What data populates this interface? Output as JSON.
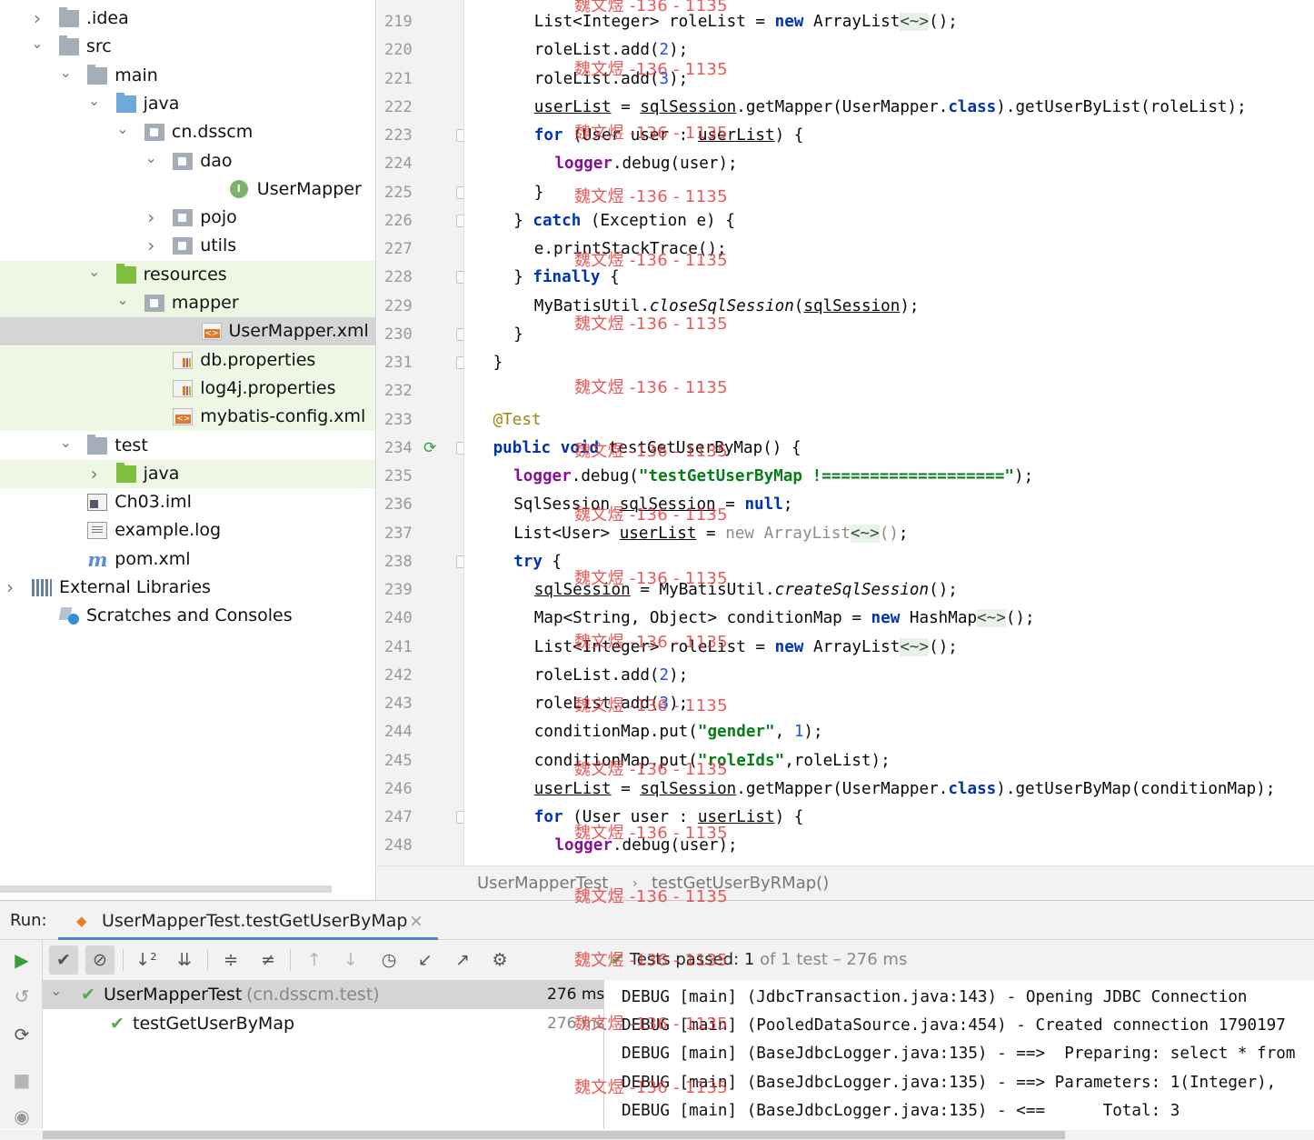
{
  "project_tree": [
    {
      "label": ".idea",
      "depth": 1,
      "arrow": "right",
      "icon": "folder-icon",
      "kind": "folder",
      "highlight": "none"
    },
    {
      "label": "src",
      "depth": 1,
      "arrow": "down",
      "icon": "folder-icon",
      "kind": "folder",
      "highlight": "none"
    },
    {
      "label": "main",
      "depth": 2,
      "arrow": "down",
      "icon": "folder-icon",
      "kind": "folder",
      "highlight": "none"
    },
    {
      "label": "java",
      "depth": 3,
      "arrow": "down",
      "icon": "source-folder-icon",
      "kind": "folder blue",
      "highlight": "none"
    },
    {
      "label": "cn.dsscm",
      "depth": 4,
      "arrow": "down",
      "icon": "package-icon",
      "kind": "pkg",
      "highlight": "none"
    },
    {
      "label": "dao",
      "depth": 5,
      "arrow": "down",
      "icon": "package-icon",
      "kind": "pkg",
      "highlight": "none"
    },
    {
      "label": "UserMapper",
      "depth": 7,
      "arrow": "",
      "icon": "interface-icon",
      "kind": "iface",
      "highlight": "none"
    },
    {
      "label": "pojo",
      "depth": 5,
      "arrow": "right",
      "icon": "package-icon",
      "kind": "pkg",
      "highlight": "none"
    },
    {
      "label": "utils",
      "depth": 5,
      "arrow": "right",
      "icon": "package-icon",
      "kind": "pkg",
      "highlight": "none"
    },
    {
      "label": "resources",
      "depth": 3,
      "arrow": "down",
      "icon": "resources-folder-icon",
      "kind": "folder green",
      "highlight": "green"
    },
    {
      "label": "mapper",
      "depth": 4,
      "arrow": "down",
      "icon": "package-icon",
      "kind": "pkg",
      "highlight": "green"
    },
    {
      "label": "UserMapper.xml",
      "depth": 6,
      "arrow": "",
      "icon": "xml-file-icon",
      "kind": "xmlfile",
      "highlight": "selected"
    },
    {
      "label": "db.properties",
      "depth": 5,
      "arrow": "",
      "icon": "properties-file-icon",
      "kind": "propfile",
      "highlight": "green"
    },
    {
      "label": "log4j.properties",
      "depth": 5,
      "arrow": "",
      "icon": "properties-file-icon",
      "kind": "propfile",
      "highlight": "green"
    },
    {
      "label": "mybatis-config.xml",
      "depth": 5,
      "arrow": "",
      "icon": "xml-file-icon",
      "kind": "xmlfile",
      "highlight": "green"
    },
    {
      "label": "test",
      "depth": 2,
      "arrow": "down",
      "icon": "folder-icon",
      "kind": "folder",
      "highlight": "none"
    },
    {
      "label": "java",
      "depth": 3,
      "arrow": "right",
      "icon": "test-folder-icon",
      "kind": "folder green",
      "highlight": "green"
    },
    {
      "label": "Ch03.iml",
      "depth": 2,
      "arrow": "",
      "icon": "iml-file-icon",
      "kind": "imlfile",
      "highlight": "none"
    },
    {
      "label": "example.log",
      "depth": 2,
      "arrow": "",
      "icon": "log-file-icon",
      "kind": "logfile",
      "highlight": "none"
    },
    {
      "label": "pom.xml",
      "depth": 2,
      "arrow": "",
      "icon": "maven-icon",
      "kind": "mvnicon",
      "highlight": "none"
    },
    {
      "label": "External Libraries",
      "depth": 1,
      "arrow": "right",
      "icon": "library-icon",
      "kind": "libicon",
      "highlight": "none",
      "noindent": true
    },
    {
      "label": "Scratches and Consoles",
      "depth": 1,
      "arrow": "",
      "icon": "scratches-icon",
      "kind": "scricon",
      "highlight": "none"
    }
  ],
  "editor": {
    "lines": [
      {
        "n": "219",
        "indent": 6,
        "fold": false,
        "html": "List&lt;Integer&gt; roleList = <span class=\"kw\">new</span> ArrayList<span class=\"dia\">&lt;~&gt;</span>();"
      },
      {
        "n": "220",
        "indent": 6,
        "fold": false,
        "html": "roleList.add(<span class=\"nm\">2</span>);"
      },
      {
        "n": "221",
        "indent": 6,
        "fold": false,
        "html": "roleList.add(<span class=\"nm\">3</span>);"
      },
      {
        "n": "222",
        "indent": 6,
        "fold": false,
        "html": "<span class=\"ul\">userList</span> = <span class=\"ul\">sqlSession</span>.getMapper(UserMapper.<span class=\"kw\">class</span>).getUserByList(roleList);"
      },
      {
        "n": "223",
        "indent": 6,
        "fold": true,
        "html": "<span class=\"kw\">for</span> (User user : <span class=\"ul\">userList</span>) {"
      },
      {
        "n": "224",
        "indent": 8,
        "fold": false,
        "html": "<span class=\"fld\">logger</span>.debug(user);"
      },
      {
        "n": "225",
        "indent": 6,
        "fold": true,
        "html": "}"
      },
      {
        "n": "226",
        "indent": 4,
        "fold": true,
        "html": "} <span class=\"kw\">catch</span> (Exception e) {"
      },
      {
        "n": "227",
        "indent": 6,
        "fold": false,
        "html": "e.printStackTrace();"
      },
      {
        "n": "228",
        "indent": 4,
        "fold": true,
        "html": "} <span class=\"kw\">finally</span> {"
      },
      {
        "n": "229",
        "indent": 6,
        "fold": false,
        "html": "MyBatisUtil.<span class=\"it\">closeSqlSession</span>(<span class=\"ul\">sqlSession</span>);"
      },
      {
        "n": "230",
        "indent": 4,
        "fold": true,
        "html": "}"
      },
      {
        "n": "231",
        "indent": 2,
        "fold": true,
        "html": "}"
      },
      {
        "n": "232",
        "indent": 0,
        "fold": false,
        "html": ""
      },
      {
        "n": "233",
        "indent": 2,
        "fold": false,
        "html": "<span class=\"an\">@Test</span>"
      },
      {
        "n": "234",
        "indent": 2,
        "fold": true,
        "run": true,
        "html": "<span class=\"kw\">public void</span> testGetUserByMap() {"
      },
      {
        "n": "235",
        "indent": 4,
        "fold": false,
        "html": "<span class=\"fld\">logger</span>.debug(<span class=\"st\">\"testGetUserByMap !===================\"</span>);"
      },
      {
        "n": "236",
        "indent": 4,
        "fold": false,
        "html": "SqlSession <span class=\"ul\">sqlSession</span> = <span class=\"kw\">null</span>;"
      },
      {
        "n": "237",
        "indent": 4,
        "fold": false,
        "html": "List&lt;User&gt; <span class=\"ul\">userList</span> = <span class=\"gr\">new ArrayList</span><span class=\"dia\">&lt;~&gt;</span><span class=\"gr\">()</span>;"
      },
      {
        "n": "238",
        "indent": 4,
        "fold": true,
        "html": "<span class=\"kw\">try</span> {"
      },
      {
        "n": "239",
        "indent": 6,
        "fold": false,
        "html": "<span class=\"ul\">sqlSession</span> = MyBatisUtil.<span class=\"it\">createSqlSession</span>();"
      },
      {
        "n": "240",
        "indent": 6,
        "fold": false,
        "html": "Map&lt;String, Object&gt; conditionMap = <span class=\"kw\">new</span> HashMap<span class=\"dia\">&lt;~&gt;</span>();"
      },
      {
        "n": "241",
        "indent": 6,
        "fold": false,
        "html": "List&lt;Integer&gt; roleList = <span class=\"kw\">new</span> ArrayList<span class=\"dia\">&lt;~&gt;</span>();"
      },
      {
        "n": "242",
        "indent": 6,
        "fold": false,
        "html": "roleList.add(<span class=\"nm\">2</span>);"
      },
      {
        "n": "243",
        "indent": 6,
        "fold": false,
        "html": "roleList.add(<span class=\"nm\">3</span>);"
      },
      {
        "n": "244",
        "indent": 6,
        "fold": false,
        "html": "conditionMap.put(<span class=\"st\">\"gender\"</span>, <span class=\"nm\">1</span>);"
      },
      {
        "n": "245",
        "indent": 6,
        "fold": false,
        "html": "conditionMap.put(<span class=\"st\">\"roleIds\"</span>,roleList);"
      },
      {
        "n": "246",
        "indent": 6,
        "fold": false,
        "html": "<span class=\"ul\">userList</span> = <span class=\"ul\">sqlSession</span>.getMapper(UserMapper.<span class=\"kw\">class</span>).getUserByMap(conditionMap);"
      },
      {
        "n": "247",
        "indent": 6,
        "fold": true,
        "html": "<span class=\"kw\">for</span> (User user : <span class=\"ul\">userList</span>) {"
      },
      {
        "n": "248",
        "indent": 8,
        "fold": false,
        "html": "<span class=\"fld\">logger</span>.debug(user);"
      }
    ]
  },
  "breadcrumb": {
    "class_name": "UserMapperTest",
    "separator": "›",
    "method_name": "testGetUserByRMap()"
  },
  "run_window": {
    "label": "Run:",
    "tab_title": "UserMapperTest.testGetUserByMap",
    "status": {
      "prefix": "Tests passed:",
      "count": "1",
      "suffix": "of 1 test – 276 ms"
    },
    "results": [
      {
        "name": "UserMapperTest",
        "package": "(cn.dsscm.test)",
        "duration": "276 ms",
        "selected": true,
        "arrow": "⌄"
      },
      {
        "name": "testGetUserByMap",
        "package": "",
        "duration": "276 ms",
        "selected": false,
        "arrow": ""
      }
    ],
    "console": [
      "DEBUG [main] (JdbcTransaction.java:143) - Opening JDBC Connection",
      "DEBUG [main] (PooledDataSource.java:454) - Created connection 1790197",
      "DEBUG [main] (BaseJdbcLogger.java:135) - ==>  Preparing: select * from",
      "DEBUG [main] (BaseJdbcLogger.java:135) - ==> Parameters: 1(Integer),",
      "DEBUG [main] (BaseJdbcLogger.java:135) - <==      Total: 3"
    ]
  },
  "watermark": {
    "text": "魏文煜 -136 - 1135"
  },
  "colors": {
    "keyword": "#0033b3",
    "string": "#067d17",
    "field": "#871094",
    "annotation": "#9e880d",
    "success": "#4caf50",
    "tab_underline": "#4a88c7",
    "watermark": "#e63c3c"
  }
}
